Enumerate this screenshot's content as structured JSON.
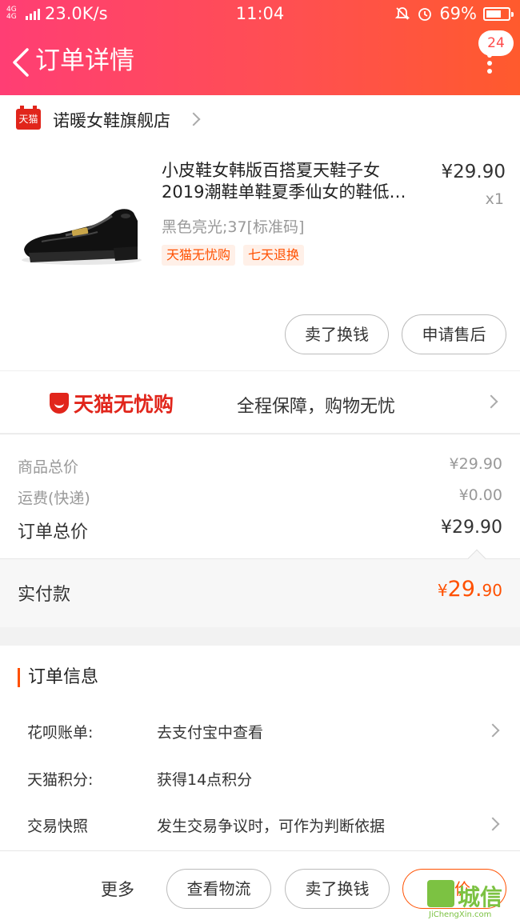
{
  "status_bar": {
    "network_speed": "23.0K/s",
    "network_small": "4G 4G",
    "time": "11:04",
    "battery": "69%",
    "battery_level": 0.69
  },
  "header": {
    "title": "订单详情",
    "badge_count": "24"
  },
  "shop": {
    "logo_text": "天猫",
    "name": "诺暖女鞋旗舰店"
  },
  "product": {
    "title_line1": "小皮鞋女韩版百搭夏天鞋子女",
    "title_line2": "2019潮鞋单鞋夏季仙女的鞋低…",
    "price": "¥29.90",
    "qty": "x1",
    "spec": "黑色亮光;37[标准码]",
    "tags": [
      "天猫无忧购",
      "七天退换"
    ],
    "buttons": [
      "卖了换钱",
      "申请售后"
    ]
  },
  "assurance": {
    "brand": "天猫无忧购",
    "desc": "全程保障，购物无忧"
  },
  "costs": {
    "goods_label": "商品总价",
    "goods_value": "¥29.90",
    "shipping_label": "运费(快递)",
    "shipping_value": "¥0.00",
    "order_total_label": "订单总价",
    "order_total_value": "¥29.90",
    "paid_label": "实付款",
    "paid_symbol": "¥",
    "paid_int": "29.",
    "paid_dec": "90"
  },
  "order_info": {
    "heading": "订单信息",
    "rows": [
      {
        "key": "花呗账单:",
        "value": "去支付宝中查看"
      },
      {
        "key": "天猫积分:",
        "value": "获得14点积分"
      },
      {
        "key": "交易快照",
        "value": "发生交易争议时，可作为判断依据"
      }
    ]
  },
  "bottom_bar": {
    "more": "更多",
    "buttons": [
      "查看物流",
      "卖了换钱",
      "评价"
    ]
  },
  "watermark": {
    "text": "城信",
    "sub": "JiChengXin.com"
  },
  "colors": {
    "header_gradient_start": "#ff3e74",
    "header_gradient_end": "#ff5a2d",
    "accent": "#ff5000",
    "tmall_red": "#e1251b"
  }
}
